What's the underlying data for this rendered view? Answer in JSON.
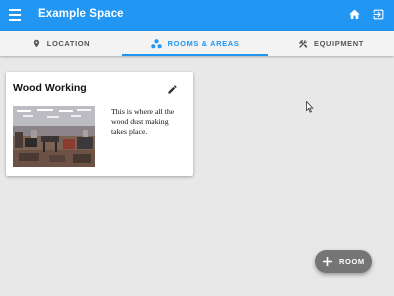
{
  "app": {
    "title": "Example Space",
    "accent_color": "#2196f3"
  },
  "tabs": [
    {
      "label": "LOCATION",
      "icon": "map-pin-icon",
      "active": false
    },
    {
      "label": "ROOMS & AREAS",
      "icon": "circles-group-icon",
      "active": true
    },
    {
      "label": "EQUIPMENT",
      "icon": "tools-icon",
      "active": false
    }
  ],
  "room_card": {
    "title": "Wood Working",
    "description": "This is where all the wood dust making takes place.",
    "edit_icon": "pencil-icon"
  },
  "fab": {
    "label": "ROOM",
    "icon": "plus-icon"
  }
}
